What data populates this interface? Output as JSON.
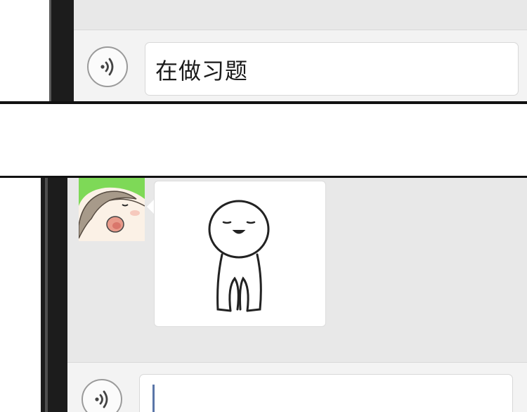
{
  "top_panel": {
    "input_value": "在做习题",
    "voice_icon": "voice-wave-icon"
  },
  "bottom_panel": {
    "avatar_icon": "cartoon-avatar-icon",
    "sticker_icon": "doodle-character-sticker",
    "input_value": "",
    "voice_icon": "voice-wave-icon"
  },
  "colors": {
    "screen_bg": "#e8e8e8",
    "input_bar_bg": "#f3f3f3",
    "avatar_bg": "#7ed957",
    "cursor": "#5a76a8",
    "bezel": "#1c1c1c"
  }
}
